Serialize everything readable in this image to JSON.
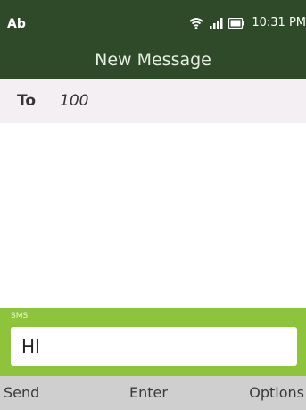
{
  "status_bar": {
    "carrier_label": "Ab",
    "time": "10:31 PM",
    "icons": [
      "wifi-icon",
      "signal-icon",
      "battery-icon"
    ]
  },
  "header": {
    "title": "New Message"
  },
  "recipient": {
    "label": "To",
    "value": "100"
  },
  "composer": {
    "type_label": "SMS",
    "text": "HI"
  },
  "softkeys": {
    "left": "Send",
    "center": "Enter",
    "right": "Options"
  },
  "colors": {
    "header_bg": "#2f4a28",
    "composer_bg": "#8ec43c",
    "softkey_bg": "#cfcfcf",
    "recipient_bg": "#f4eff3"
  }
}
